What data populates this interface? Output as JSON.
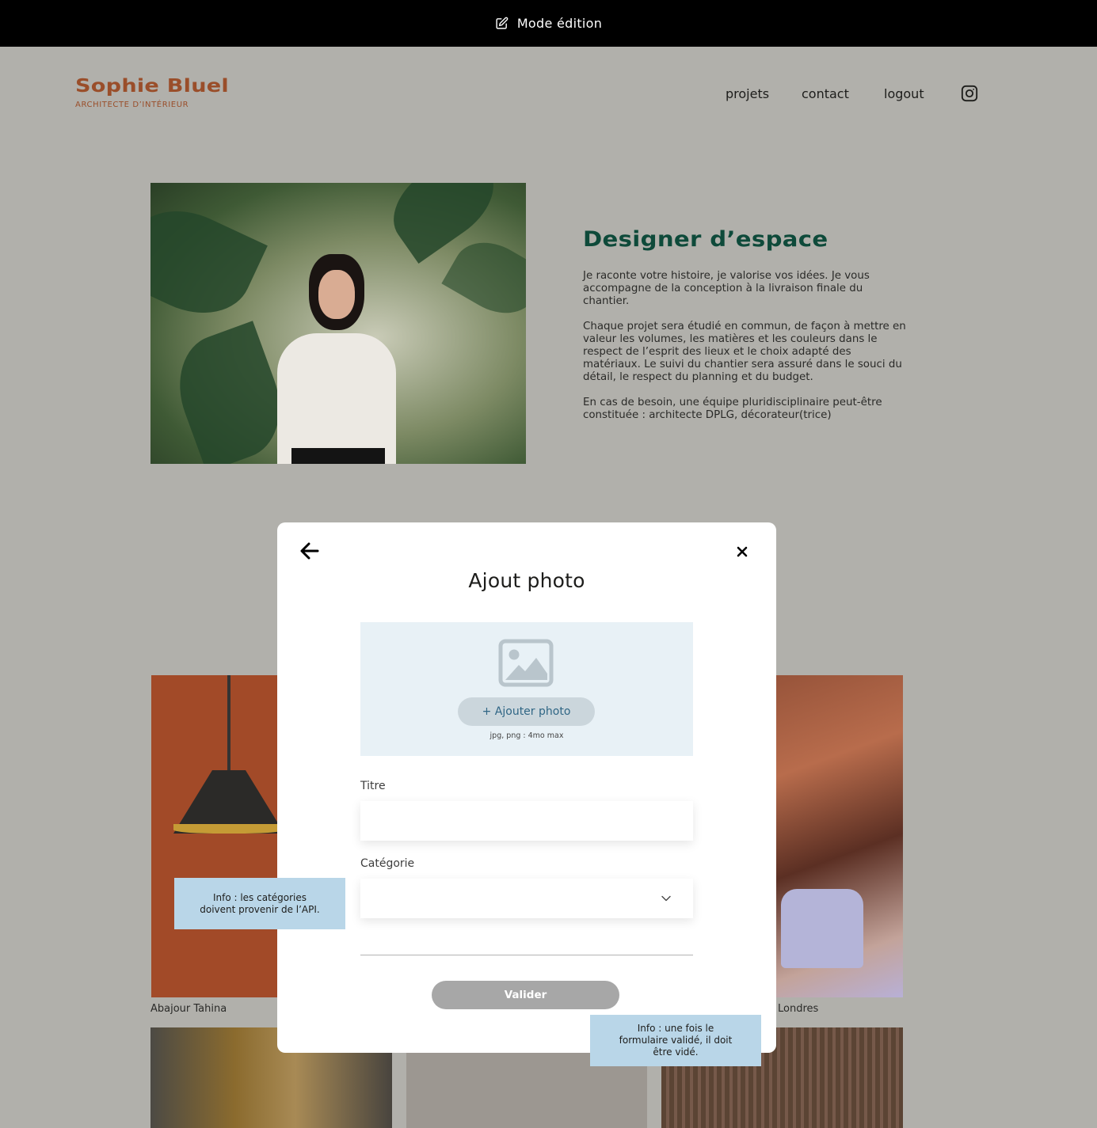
{
  "edit_bar": {
    "label": "Mode édition",
    "icon": "edit-icon"
  },
  "header": {
    "brand_name": "Sophie Bluel",
    "brand_subtitle": "ARCHITECTE D’INTÉRIEUR",
    "nav": [
      "projets",
      "contact",
      "logout"
    ],
    "social_icon": "instagram-icon"
  },
  "intro": {
    "title": "Designer d’espace",
    "paragraphs": [
      "Je raconte votre histoire, je valorise vos idées. Je vous accompagne de la conception à la livraison finale du chantier.",
      "Chaque projet sera étudié en commun, de façon à mettre en valeur les volumes, les matières et les couleurs dans le respect de l’esprit des lieux et le choix adapté des matériaux. Le suivi du chantier sera assuré dans le souci du détail, le respect du planning et du budget.",
      "En cas de besoin, une équipe pluridisciplinaire peut-être constituée : architecte DPLG, décorateur(trice)"
    ]
  },
  "gallery": {
    "captions": [
      "Abajour Tahina",
      "Londres"
    ]
  },
  "modal": {
    "title": "Ajout photo",
    "add_photo_label": "+ Ajouter photo",
    "upload_hint": "jpg, png : 4mo max",
    "title_label": "Titre",
    "title_value": "",
    "category_label": "Catégorie",
    "category_value": "",
    "submit_label": "Valider"
  },
  "notes": [
    "Info : les catégories doivent provenir de l’API.",
    "Info : une fois le formulaire validé, il doit être vidé."
  ],
  "colors": {
    "overlay_background": "#b1b0ab",
    "brand": "#9a4e2a",
    "intro_title": "#0e4a3a",
    "upload_area": "#e8f1f6",
    "add_photo_text": "#306685",
    "submit_disabled": "#a7a7a7",
    "note_background": "#b9d6e8"
  }
}
